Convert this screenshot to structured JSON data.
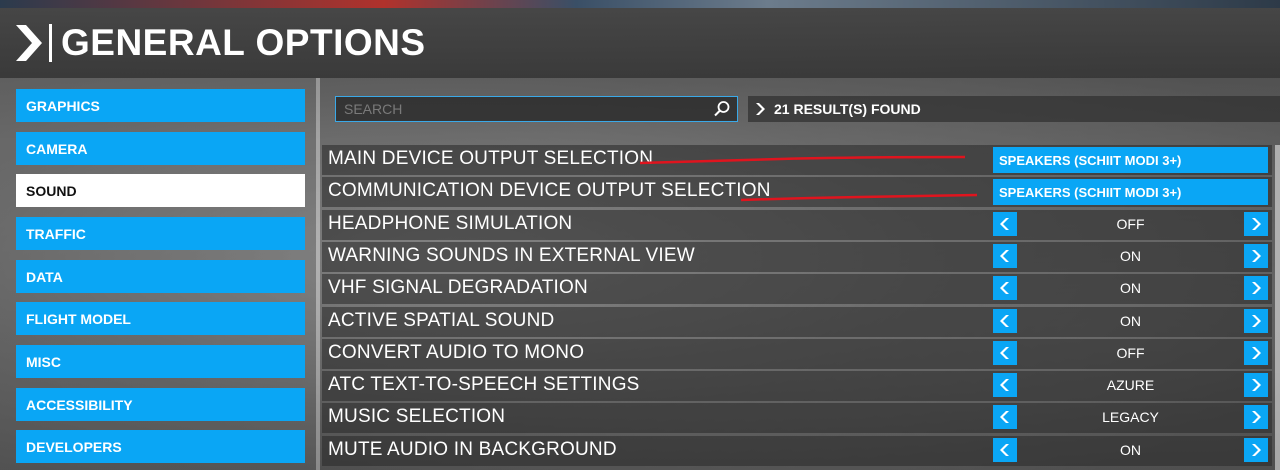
{
  "header": {
    "title": "GENERAL OPTIONS"
  },
  "sidebar": {
    "items": [
      {
        "label": "GRAPHICS",
        "active": false
      },
      {
        "label": "CAMERA",
        "active": false
      },
      {
        "label": "SOUND",
        "active": true
      },
      {
        "label": "TRAFFIC",
        "active": false
      },
      {
        "label": "DATA",
        "active": false
      },
      {
        "label": "FLIGHT MODEL",
        "active": false
      },
      {
        "label": "MISC",
        "active": false
      },
      {
        "label": "ACCESSIBILITY",
        "active": false
      },
      {
        "label": "DEVELOPERS",
        "active": false
      }
    ]
  },
  "search": {
    "placeholder": "SEARCH",
    "value": ""
  },
  "results": {
    "label": "21 RESULT(S) FOUND"
  },
  "settings": [
    {
      "label": "MAIN DEVICE OUTPUT SELECTION",
      "type": "dropdown",
      "value": "SPEAKERS (SCHIIT MODI 3+)"
    },
    {
      "label": "COMMUNICATION DEVICE OUTPUT SELECTION",
      "type": "dropdown",
      "value": "SPEAKERS (SCHIIT MODI 3+)"
    },
    {
      "label": "HEADPHONE SIMULATION",
      "type": "toggle",
      "value": "OFF"
    },
    {
      "label": "WARNING SOUNDS IN EXTERNAL VIEW",
      "type": "toggle",
      "value": "ON"
    },
    {
      "label": "VHF SIGNAL DEGRADATION",
      "type": "toggle",
      "value": "ON"
    },
    {
      "label": "ACTIVE SPATIAL SOUND",
      "type": "toggle",
      "value": "ON"
    },
    {
      "label": "CONVERT AUDIO TO MONO",
      "type": "toggle",
      "value": "OFF"
    },
    {
      "label": "ATC TEXT-TO-SPEECH SETTINGS",
      "type": "toggle",
      "value": "AZURE"
    },
    {
      "label": "MUSIC SELECTION",
      "type": "toggle",
      "value": "LEGACY"
    },
    {
      "label": "MUTE AUDIO IN BACKGROUND",
      "type": "toggle",
      "value": "ON"
    }
  ],
  "colors": {
    "accent": "#0aa6f5",
    "annotation": "#e0141e"
  }
}
